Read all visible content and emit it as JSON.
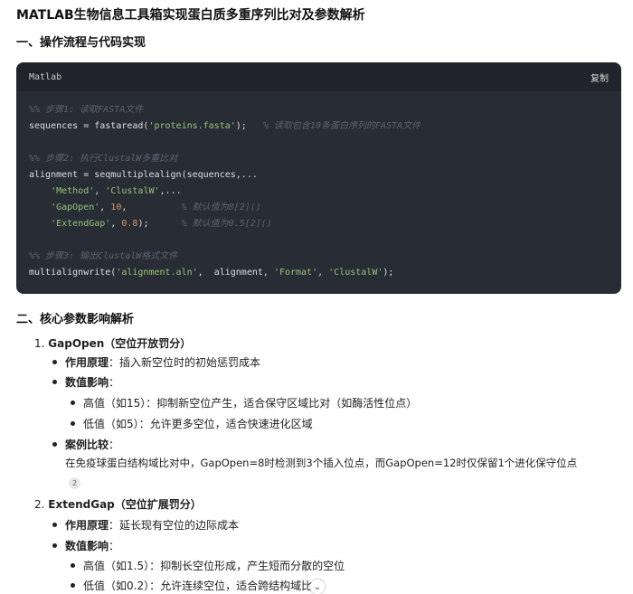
{
  "title": "MATLAB生物信息工具箱实现蛋白质多重序列比对及参数解析",
  "section1": "一、操作流程与代码实现",
  "code": {
    "lang": "Matlab",
    "copy_label": "复制",
    "lines": [
      "%% 步骤1: 读取FASTA文件",
      "sequences = fastaread('proteins.fasta');   % 读取包含10条蛋白序列的FASTA文件",
      "",
      "%% 步骤2: 执行ClustalW多重比对",
      "alignment = seqmultiplealign(sequences,...",
      "    'Method', 'ClustalW',...",
      "    'GapOpen', 10,          % 默认值为8[2]()",
      "    'ExtendGap', 0.8);      % 默认值为0.5[2]()",
      "",
      "%% 步骤3: 输出ClustalW格式文件",
      "multialignwrite('alignment.aln',  alignment, 'Format', 'ClustalW');"
    ]
  },
  "section2": "二、核心参数影响解析",
  "params": [
    {
      "num": "1.",
      "name": "GapOpen",
      "desc": "（空位开放罚分）",
      "principle_label": "作用原理",
      "principle": "：插入新空位时的初始惩罚成本",
      "effect_label": "数值影响",
      "effect_colon": "：",
      "effects": [
        "高值（如15）：抑制新空位产生，适合保守区域比对（如酶活性位点）",
        "低值（如5）：允许更多空位，适合快速进化区域"
      ],
      "case_label": "案例比较",
      "case_colon": "：",
      "case_text": "在免疫球蛋白结构域比对中，GapOpen=8时检测到3个插入位点，而GapOpen=12时仅保留1个进化保守位点",
      "cite": "2"
    },
    {
      "num": "2.",
      "name": "ExtendGap",
      "desc": "（空位扩展罚分）",
      "principle_label": "作用原理",
      "principle": "：延长现有空位的边际成本",
      "effect_label": "数值影响",
      "effect_colon": "：",
      "effects": [
        "高值（如1.5）：抑制长空位形成，产生短而分散的空位",
        "低值（如0.2）：允许连续空位，适合跨结构域比对"
      ]
    }
  ],
  "scroll_icon": "chevron-down-icon"
}
